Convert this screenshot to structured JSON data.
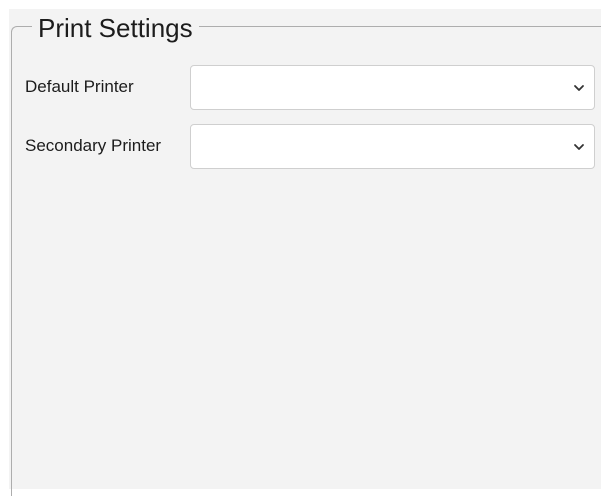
{
  "group": {
    "title": "Print Settings"
  },
  "fields": [
    {
      "label": "Default Printer",
      "value": "",
      "icon": "chevron-down-icon"
    },
    {
      "label": "Secondary Printer",
      "value": "",
      "icon": "chevron-down-icon"
    }
  ],
  "colors": {
    "panel_background": "#f3f3f3",
    "input_background": "#ffffff",
    "border": "#adadad",
    "text": "#1c1c1c"
  }
}
